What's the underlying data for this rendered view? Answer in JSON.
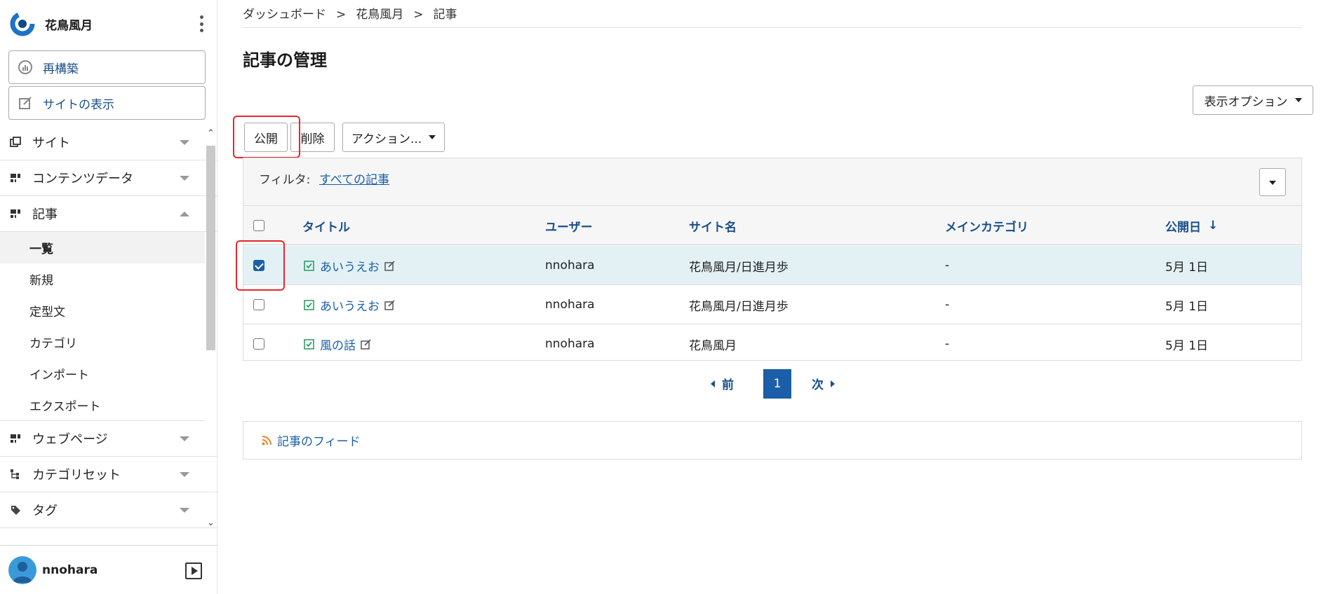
{
  "brand": {
    "name": "花鳥風月"
  },
  "sidebar": {
    "rebuild_label": "再構築",
    "view_site_label": "サイトの表示",
    "nav": [
      {
        "label": "サイト",
        "icon": "copy-icon",
        "expanded": false
      },
      {
        "label": "コンテンツデータ",
        "icon": "grid-icon",
        "expanded": false
      },
      {
        "label": "記事",
        "icon": "grid-icon",
        "expanded": true
      }
    ],
    "entry_sub": [
      "一覧",
      "新規",
      "定型文",
      "カテゴリ",
      "インポート",
      "エクスポート"
    ],
    "nav_after": [
      {
        "label": "ウェブページ",
        "icon": "grid-icon"
      },
      {
        "label": "カテゴリセット",
        "icon": "tree-icon"
      },
      {
        "label": "タグ",
        "icon": "tag-icon"
      }
    ]
  },
  "user": {
    "name": "nnohara"
  },
  "breadcrumb": [
    "ダッシュボード",
    "花鳥風月",
    "記事"
  ],
  "breadcrumb_sep": ">",
  "page_title": "記事の管理",
  "toolbar": {
    "display_options_label": "表示オプション",
    "publish_label": "公開",
    "delete_label": "削除",
    "actions_label": "アクション..."
  },
  "filter": {
    "label": "フィルタ:",
    "value": "すべての記事"
  },
  "table": {
    "columns": [
      "タイトル",
      "ユーザー",
      "サイト名",
      "メインカテゴリ",
      "公開日"
    ],
    "sort_indicator": "↓",
    "rows": [
      {
        "title": "あいうえお",
        "user": "nnohara",
        "site": "花鳥風月/日進月歩",
        "category": "-",
        "date": "5月 1日",
        "checked": true
      },
      {
        "title": "あいうえお",
        "user": "nnohara",
        "site": "花鳥風月/日進月歩",
        "category": "-",
        "date": "5月 1日",
        "checked": false
      },
      {
        "title": "風の話",
        "user": "nnohara",
        "site": "花鳥風月",
        "category": "-",
        "date": "5月 1日",
        "checked": false
      }
    ]
  },
  "pager": {
    "prev": "前",
    "current": "1",
    "next": "次"
  },
  "feed": {
    "label": "記事のフィード"
  },
  "colors": {
    "accent": "#1a5fa8",
    "highlight": "#e8262b",
    "selected_row": "#e3f1f5",
    "status_green": "#2e9e6b",
    "feed_orange": "#e8862b"
  }
}
